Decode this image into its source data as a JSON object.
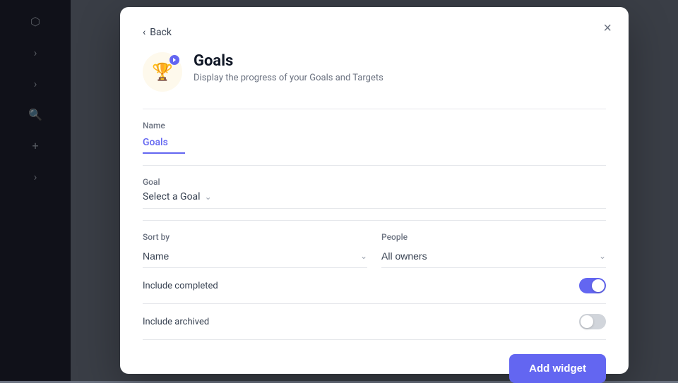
{
  "sidebar": {
    "icons": [
      "⬡",
      ">",
      ">",
      "🔍",
      "+",
      ">"
    ]
  },
  "modal": {
    "back_label": "Back",
    "close_label": "×",
    "icon_emoji": "🏆",
    "title": "Goals",
    "description": "Display the progress of your Goals and Targets",
    "name_label": "Name",
    "name_value": "Goals",
    "goal_label": "Goal",
    "goal_placeholder": "Select a Goal",
    "sort_label": "Sort by",
    "sort_value": "Name",
    "people_label": "People",
    "people_value": "All owners",
    "include_completed_label": "Include completed",
    "include_completed_on": true,
    "include_archived_label": "Include archived",
    "include_archived_on": false,
    "add_widget_label": "Add widget"
  }
}
